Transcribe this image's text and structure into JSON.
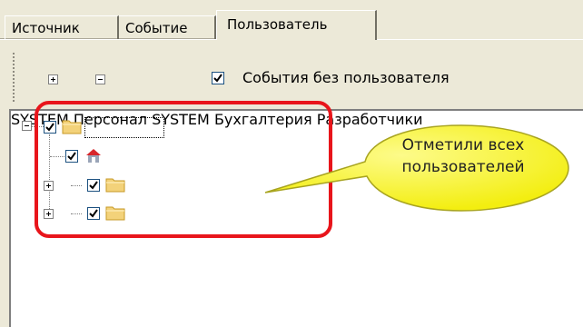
{
  "tabs": {
    "source": "Источник",
    "event": "Событие",
    "user": "Пользователь"
  },
  "toolbar": {
    "no_user_events_label": "События без пользователя",
    "no_user_events_checked": true
  },
  "tree": {
    "root": {
      "label": "SYSTEM",
      "checked": true,
      "icon": "folder-icon"
    },
    "children": [
      {
        "label": "Персонал SYSTEM",
        "checked": true,
        "icon": "user-house-icon"
      },
      {
        "label": "Бухгалтерия",
        "checked": true,
        "icon": "folder-icon"
      },
      {
        "label": "Разработчики",
        "checked": true,
        "icon": "folder-icon"
      }
    ]
  },
  "callout": {
    "line1": "Отметили всех",
    "line2": "пользователей",
    "fill_color": "#f7f51d"
  },
  "highlight_color": "#e8151b"
}
